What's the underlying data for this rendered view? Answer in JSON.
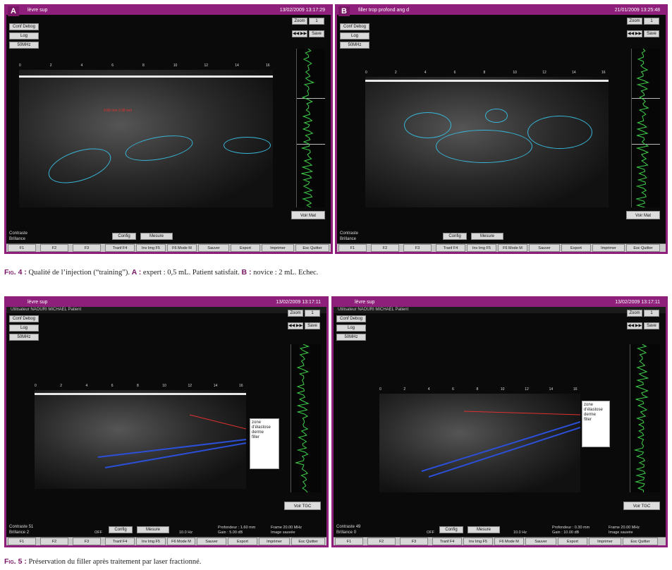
{
  "fig4": {
    "caption_label": "Fig. 4 :",
    "caption_text": " Qualité de l’injection (“training”). ",
    "caption_a_label": "A :",
    "caption_a_text": " expert : 0,5 mL. Patient satisfait. ",
    "caption_b_label": "B :",
    "caption_b_text": " novice : 2 mL. Echec.",
    "panels": [
      {
        "letter": "A",
        "title": "lèvre sup",
        "datetime": "13/02/2009  13:17:29",
        "zoom_label": "Zoom",
        "zoom_value": "1",
        "save_label": "Save",
        "conf_label": "Conf Debog",
        "log_label": "Log",
        "mhz_label": "50MHz",
        "voir_label": "Voir Mat",
        "status_contraste": "Contraste",
        "status_brillance": "Brillance",
        "config_label": "Config",
        "mesure_label": "Mesure"
      },
      {
        "letter": "B",
        "title": "filler trop profond ang d",
        "datetime": "21/01/2009  13:25:48",
        "zoom_label": "Zoom",
        "zoom_value": "1",
        "save_label": "Save",
        "conf_label": "Conf Debog",
        "log_label": "Log",
        "mhz_label": "50MHz",
        "voir_label": "Voir Mat",
        "status_contraste": "Contraste",
        "status_brillance": "Brillance",
        "config_label": "Config",
        "mesure_label": "Mesure"
      }
    ]
  },
  "fig5": {
    "caption_label": "Fig. 5 :",
    "caption_text": " Préservation du filler après traitement par laser fractionné.",
    "panels": [
      {
        "title": "lèvre sup",
        "operator": "Utilisateur NAOURI MICHAEL      Patient",
        "datetime": "13/02/2009  13:17:11",
        "zoom_label": "Zoom",
        "zoom_value": "1",
        "save_label": "Save",
        "conf_label": "Conf Debog",
        "log_label": "Log",
        "mhz_label": "50MHz",
        "voir_label": "Voir TGC",
        "status_contraste": "Contraste",
        "status_brillance": "Brillance",
        "contraste_val": "51",
        "brillance_val": "2",
        "config_label": "Config",
        "mesure_label": "Mesure",
        "off_label": "OFF",
        "profondeur": "Profondeur : 1.60 mm",
        "gain": "Gain : 5.00 dB",
        "frame": "Frame 20.00 MHz",
        "image": "Image sauvée",
        "depth_label": "10.0 Hz",
        "legend": [
          "zone",
          "d'élastose",
          "derme",
          "filler"
        ]
      },
      {
        "title": "lèvre sup",
        "operator": "Utilisateur NAOURI MICHAEL      Patient",
        "datetime": "13/02/2009  13:17:11",
        "zoom_label": "Zoom",
        "zoom_value": "1",
        "save_label": "Save",
        "conf_label": "Conf Debog",
        "log_label": "Log",
        "mhz_label": "50MHz",
        "voir_label": "Voir TGC",
        "status_contraste": "Contraste",
        "status_brillance": "Brillance",
        "contraste_val": "49",
        "brillance_val": "0",
        "config_label": "Config",
        "mesure_label": "Mesure",
        "off_label": "OFF",
        "profondeur": "Profondeur : 0.30 mm",
        "gain": "Gain : 10.00 dB",
        "frame": "Frame 20.00 MHz",
        "image": "Image sauvée",
        "depth_label": "10.0 Hz",
        "legend": [
          "zone",
          "d'élastose",
          "derme",
          "filler"
        ]
      }
    ]
  },
  "toolbar": {
    "f1": "F1",
    "f2": "F2",
    "f3": "F3",
    "tranf": "Tranf F4",
    "invimg": "Inv Img F5",
    "mode": "F6 Mode M",
    "sauver": "Sauver",
    "export": "Export",
    "imprimer": "Imprimer",
    "quitter": "Esc Quitter"
  },
  "axis_ticks": [
    "0",
    "2",
    "4",
    "6",
    "8",
    "10",
    "12",
    "14",
    "16"
  ],
  "colors": {
    "frame": "#8e1f7a",
    "outline": "#38b6d8",
    "measure": "#e03030",
    "filler_blue": "#2b4fd6",
    "tgc_green": "#3fd04a"
  }
}
